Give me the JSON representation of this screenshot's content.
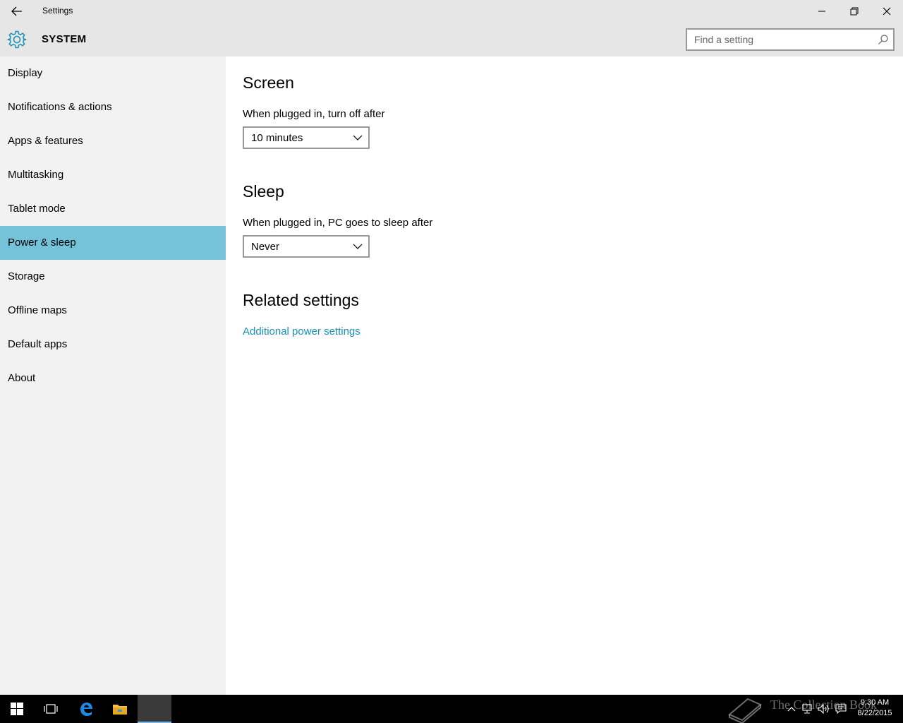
{
  "window": {
    "title": "Settings"
  },
  "header": {
    "section_title": "SYSTEM",
    "search_placeholder": "Find a setting"
  },
  "sidebar": {
    "items": [
      {
        "label": "Display"
      },
      {
        "label": "Notifications & actions"
      },
      {
        "label": "Apps & features"
      },
      {
        "label": "Multitasking"
      },
      {
        "label": "Tablet mode"
      },
      {
        "label": "Power & sleep",
        "active": true
      },
      {
        "label": "Storage"
      },
      {
        "label": "Offline maps"
      },
      {
        "label": "Default apps"
      },
      {
        "label": "About"
      }
    ]
  },
  "main": {
    "screen": {
      "heading": "Screen",
      "label": "When plugged in, turn off after",
      "value": "10 minutes"
    },
    "sleep": {
      "heading": "Sleep",
      "label": "When plugged in, PC goes to sleep after",
      "value": "Never"
    },
    "related": {
      "heading": "Related settings",
      "link": "Additional power settings"
    }
  },
  "taskbar": {
    "time": "9:30 AM",
    "date": "8/22/2015",
    "watermark": "The Collection Book"
  },
  "colors": {
    "accent": "#76c3d9",
    "link": "#1a90b8",
    "chrome": "#e6e6e6",
    "sidebar": "#f2f2f2"
  }
}
